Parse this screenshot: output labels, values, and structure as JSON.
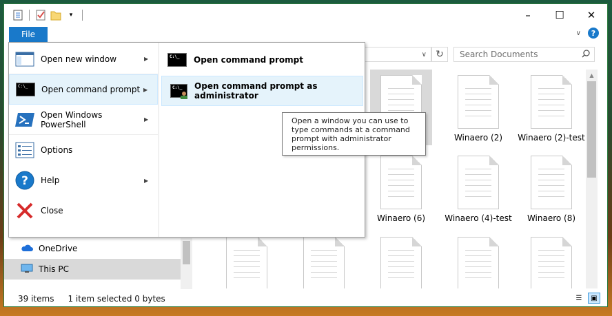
{
  "window": {
    "search_placeholder": "Search Documents",
    "file_tab": "File",
    "controls": [
      "–",
      "☐",
      "✕"
    ]
  },
  "menu": {
    "items": [
      {
        "label": "Open new window",
        "icon": "new-window-icon",
        "has_arrow": true
      },
      {
        "label": "Open command prompt",
        "icon": "cmd-icon",
        "has_arrow": true
      },
      {
        "label": "Open Windows PowerShell",
        "icon": "powershell-icon",
        "has_arrow": true
      },
      {
        "label": "Options",
        "icon": "options-icon",
        "has_arrow": false
      },
      {
        "label": "Help",
        "icon": "help-icon",
        "has_arrow": true
      },
      {
        "label": "Close",
        "icon": "close-icon",
        "has_arrow": false
      }
    ],
    "submenu": [
      {
        "label": "Open command prompt"
      },
      {
        "label": "Open command prompt as administrator"
      }
    ],
    "tooltip": "Open a window you can use to type commands at a command prompt with administrator permissions."
  },
  "files": [
    {
      "name": "Winaero (2)"
    },
    {
      "name": "Winaero (2)-test"
    },
    {
      "name": "Winaero (6)"
    },
    {
      "name": "Winaero (4)-test"
    },
    {
      "name": "Winaero (8)"
    }
  ],
  "nav": {
    "items": [
      {
        "label": "OneDrive"
      },
      {
        "label": "This PC"
      }
    ]
  },
  "status": {
    "count": "39 items",
    "selection": "1 item selected  0 bytes"
  },
  "colors": {
    "accent": "#1979ca",
    "hover": "#e5f3fb"
  }
}
